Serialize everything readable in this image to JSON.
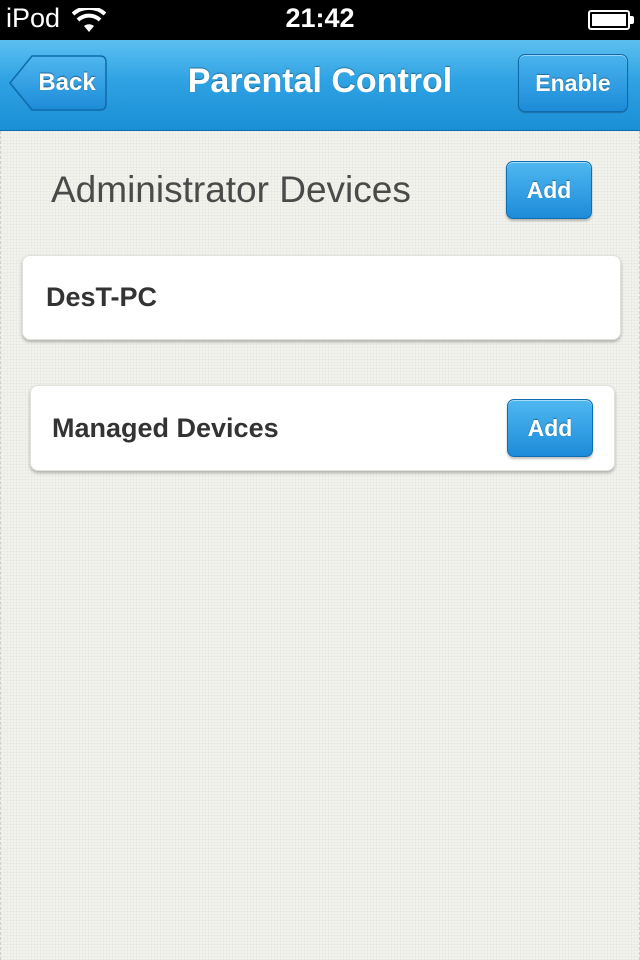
{
  "status_bar": {
    "carrier": "iPod",
    "time": "21:42",
    "wifi_icon": "wifi-icon",
    "battery_icon": "battery-icon"
  },
  "nav_bar": {
    "back_label": "Back",
    "title": "Parental Control",
    "enable_label": "Enable"
  },
  "administrator": {
    "title": "Administrator Devices",
    "add_label": "Add",
    "devices": [
      "DesT-PC"
    ]
  },
  "managed": {
    "title": "Managed Devices",
    "add_label": "Add"
  },
  "colors": {
    "accent": "#2fa2e3",
    "background": "#f3f3ee"
  }
}
